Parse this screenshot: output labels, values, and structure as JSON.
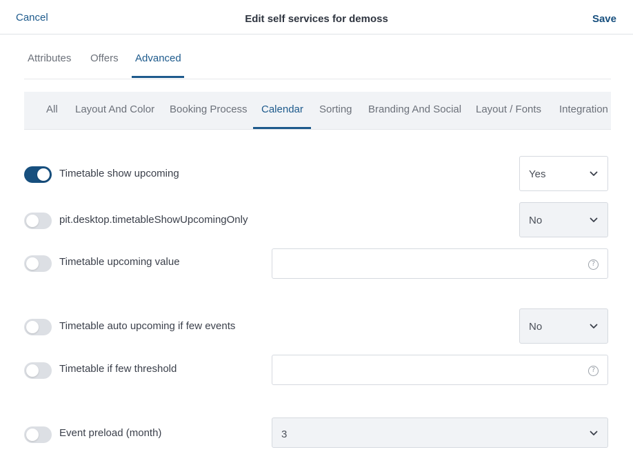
{
  "header": {
    "cancel_label": "Cancel",
    "title": "Edit self services for demoss",
    "save_label": "Save"
  },
  "tabs": [
    {
      "label": "Attributes",
      "active": false
    },
    {
      "label": "Offers",
      "active": false
    },
    {
      "label": "Advanced",
      "active": true
    }
  ],
  "subtabs": [
    {
      "label": "All",
      "active": false
    },
    {
      "label": "Layout And Color",
      "active": false
    },
    {
      "label": "Booking Process",
      "active": false
    },
    {
      "label": "Calendar",
      "active": true
    },
    {
      "label": "Sorting",
      "active": false
    },
    {
      "label": "Branding And Social",
      "active": false
    },
    {
      "label": "Layout / Fonts",
      "active": false
    },
    {
      "label": "Integration",
      "active": false
    }
  ],
  "settings": [
    {
      "label": "Timetable show upcoming",
      "enabled": true,
      "control": "select",
      "value": "Yes"
    },
    {
      "label": "pit.desktop.timetableShowUpcomingOnly",
      "enabled": false,
      "control": "select",
      "value": "No"
    },
    {
      "label": "Timetable upcoming value",
      "enabled": false,
      "control": "input",
      "value": "",
      "help_icon": "?"
    },
    {
      "label": "Timetable auto upcoming if few events",
      "enabled": false,
      "control": "select",
      "value": "No"
    },
    {
      "label": "Timetable if few threshold",
      "enabled": false,
      "control": "input",
      "value": "",
      "help_icon": "?"
    },
    {
      "label": "Event preload (month)",
      "enabled": false,
      "control": "select",
      "value": "3"
    }
  ],
  "colors": {
    "accent": "#1d5a8c",
    "toggle_on": "#174f7e",
    "toggle_off": "#dcdfe4"
  }
}
